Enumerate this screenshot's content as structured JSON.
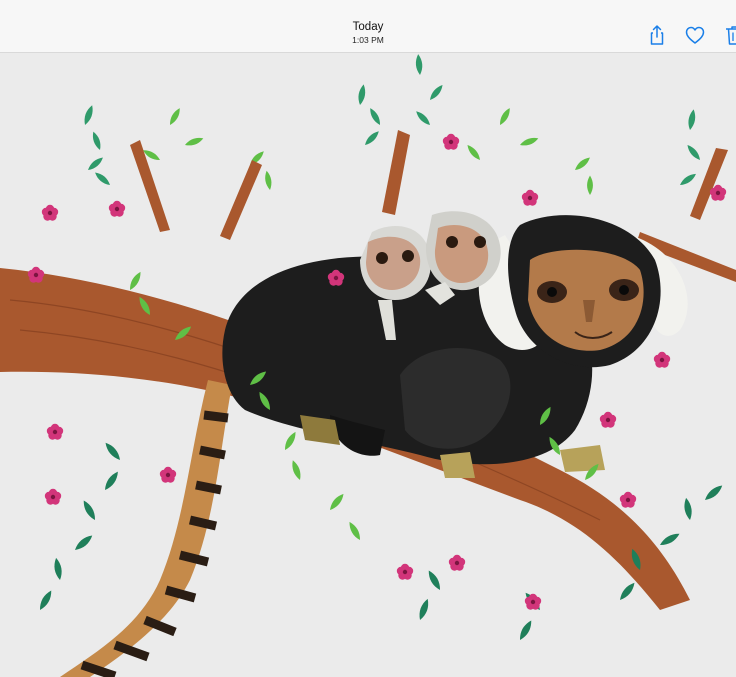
{
  "header": {
    "title": "Today",
    "subtitle": "1:03 PM"
  },
  "toolbar": {
    "share_icon": "share-icon",
    "favorite_icon": "heart-icon",
    "delete_icon": "trash-icon",
    "accent_color": "#1a7fe8"
  },
  "photo": {
    "background_color": "#ebebeb",
    "branch_color": "#a9582e",
    "leaf_colors": [
      "#2f9a6a",
      "#5fbf46",
      "#1f7f5a",
      "#8fd14f"
    ],
    "flower_color": "#d2357a",
    "monkey_fur_color": "#1d1d1d"
  }
}
